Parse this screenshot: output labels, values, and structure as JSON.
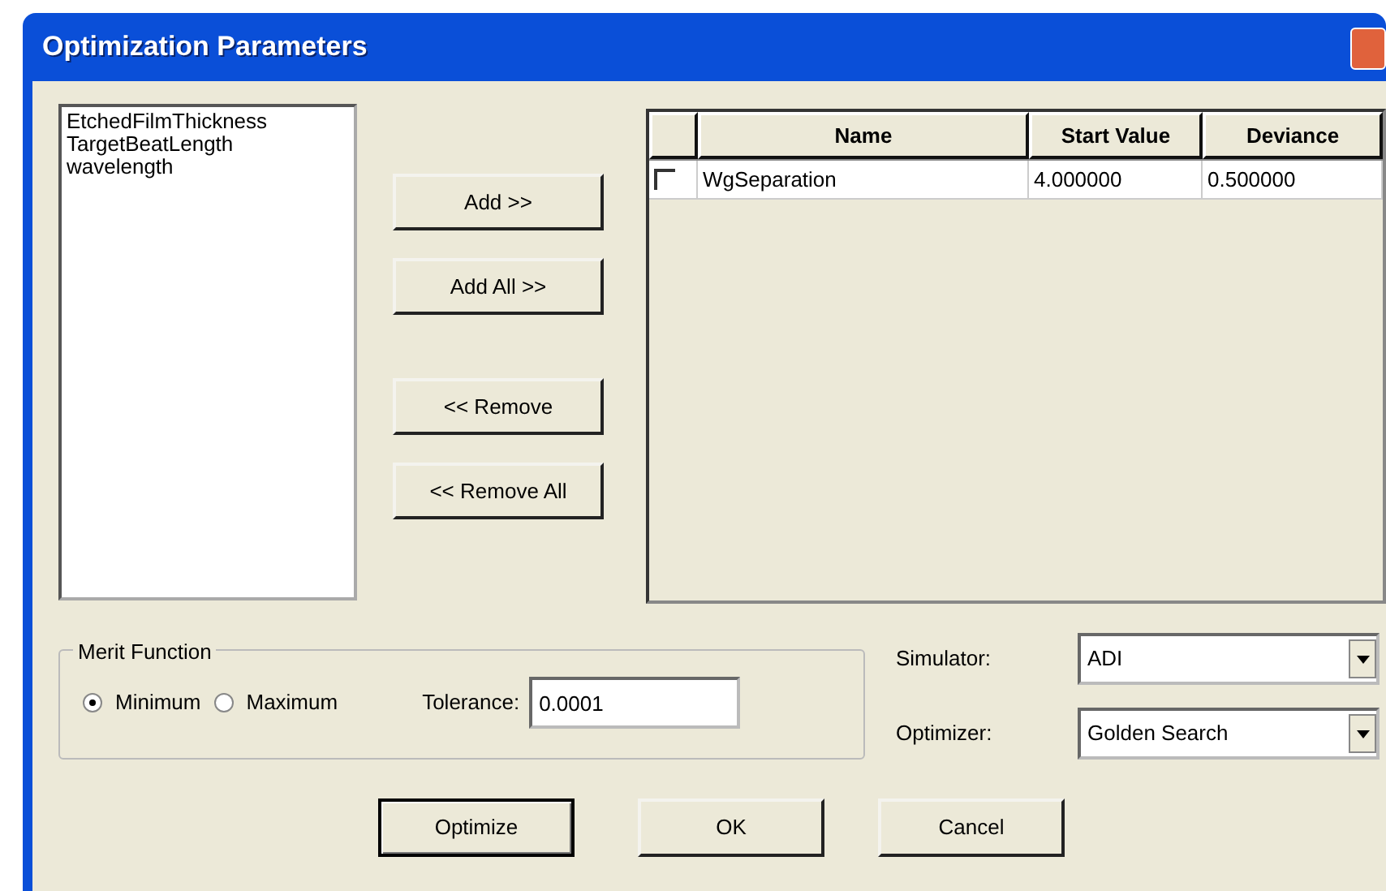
{
  "window": {
    "title": "Optimization Parameters"
  },
  "available": [
    "EtchedFilmThickness",
    "TargetBeatLength",
    "wavelength"
  ],
  "move_buttons": [
    {
      "label": "Add >>"
    },
    {
      "label": "Add All >>"
    },
    {
      "label": "<< Remove"
    },
    {
      "label": "<< Remove All"
    }
  ],
  "table": {
    "columns": [
      "Name",
      "Start Value",
      "Deviance"
    ],
    "rows": [
      {
        "checked": false,
        "cells": [
          "WgSeparation",
          "4.000000",
          "0.500000"
        ]
      }
    ]
  },
  "merit_function": {
    "title": "Merit Function",
    "options": [
      {
        "label": "Minimum",
        "selected": true
      },
      {
        "label": "Maximum",
        "selected": false
      }
    ],
    "tolerance_label": "Tolerance:",
    "tolerance": "0.0001"
  },
  "selects": [
    {
      "label": "Simulator:",
      "value": "ADI"
    },
    {
      "label": "Optimizer:",
      "value": "Golden Search"
    }
  ],
  "buttons": [
    {
      "label": "Optimize",
      "default": true
    },
    {
      "label": "OK",
      "default": false
    },
    {
      "label": "Cancel",
      "default": false
    }
  ]
}
